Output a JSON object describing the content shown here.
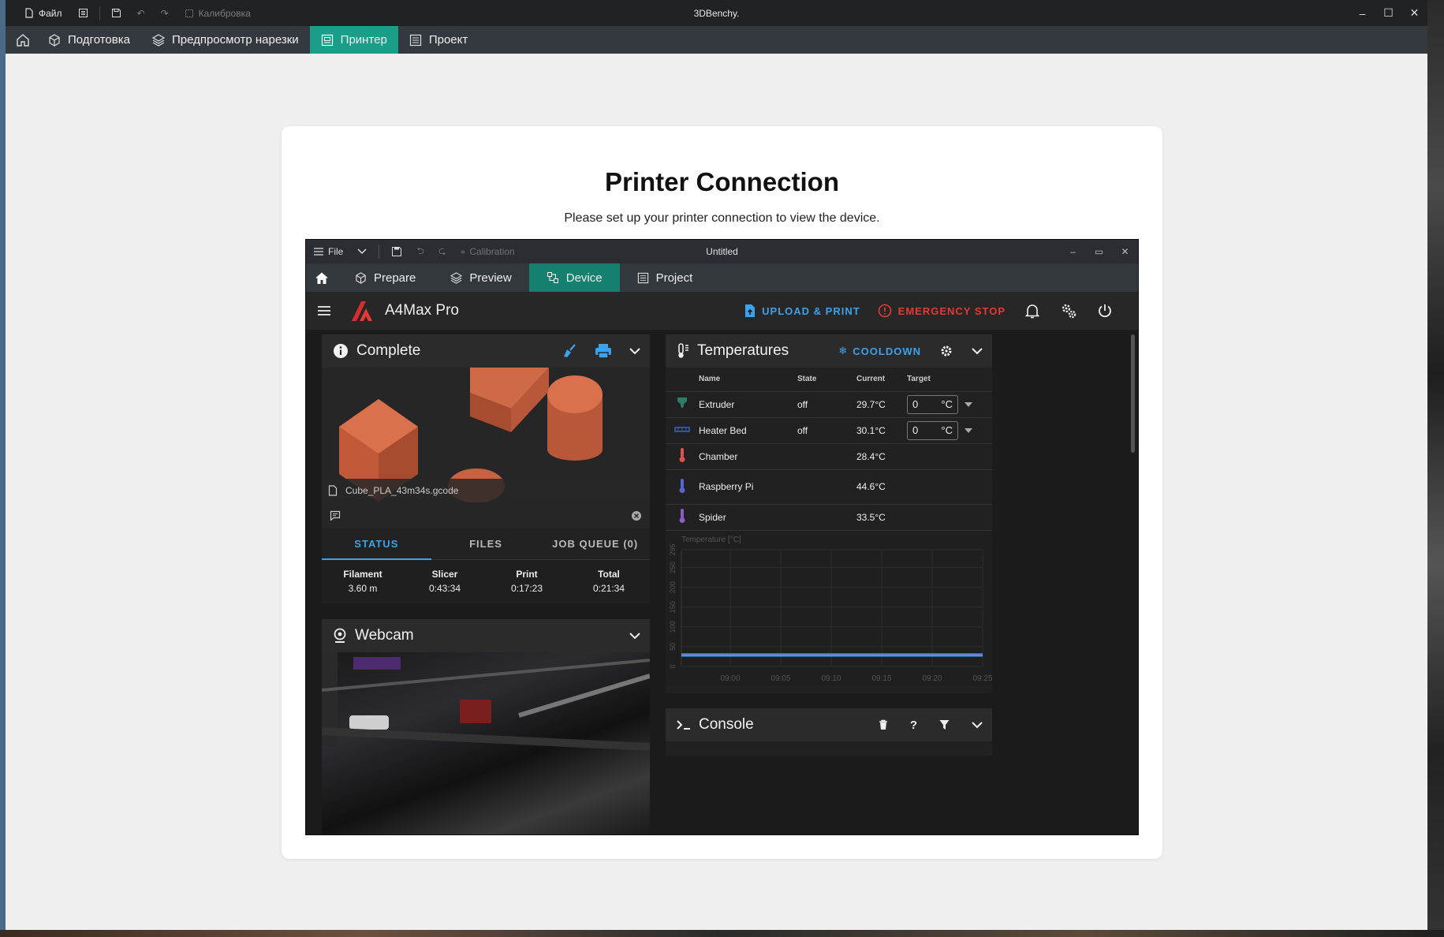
{
  "app": {
    "title": "3DBenchy.",
    "toolbar": {
      "file": "Файл",
      "calibration": "Калибровка"
    },
    "tabs": [
      {
        "label": "Подготовка"
      },
      {
        "label": "Предпросмотр нарезки"
      },
      {
        "label": "Принтер"
      },
      {
        "label": "Проект"
      }
    ]
  },
  "card": {
    "title": "Printer Connection",
    "subtitle": "Please set up your printer connection to view the device."
  },
  "device": {
    "window_title": "Untitled",
    "toolbar": {
      "file": "File",
      "calibration": "Calibration"
    },
    "tabs": [
      {
        "label": "Prepare"
      },
      {
        "label": "Preview"
      },
      {
        "label": "Device"
      },
      {
        "label": "Project"
      }
    ],
    "printer_name": "A4Max Pro",
    "upload_print": "UPLOAD & PRINT",
    "emergency_stop": "EMERGENCY STOP",
    "status_panel": {
      "title": "Complete",
      "filename": "Cube_PLA_43m34s.gcode",
      "tabs": [
        "STATUS",
        "FILES",
        "JOB QUEUE (0)"
      ],
      "stats": [
        {
          "label": "Filament",
          "value": "3.60 m"
        },
        {
          "label": "Slicer",
          "value": "0:43:34"
        },
        {
          "label": "Print",
          "value": "0:17:23"
        },
        {
          "label": "Total",
          "value": "0:21:34"
        }
      ]
    },
    "webcam": {
      "title": "Webcam"
    },
    "temperatures": {
      "title": "Temperatures",
      "cooldown": "COOLDOWN",
      "columns": {
        "name": "Name",
        "state": "State",
        "current": "Current",
        "target": "Target"
      },
      "rows": [
        {
          "name": "Extruder",
          "state": "off",
          "current": "29.7°C",
          "target": "0",
          "unit": "°C",
          "icon_color": "#2e7d68"
        },
        {
          "name": "Heater Bed",
          "state": "off",
          "current": "30.1°C",
          "target": "0",
          "unit": "°C",
          "icon_color": "#3b5bbf"
        },
        {
          "name": "Chamber",
          "state": "",
          "current": "28.4°C",
          "target": "",
          "unit": "",
          "icon_color": "#d9534f"
        },
        {
          "name": "Raspberry Pi",
          "state": "",
          "current": "44.6°C",
          "target": "",
          "unit": "",
          "icon_color": "#5565d8"
        },
        {
          "name": "Spider",
          "state": "",
          "current": "33.5°C",
          "target": "",
          "unit": "",
          "icon_color": "#8a5ec4"
        }
      ]
    },
    "console": {
      "title": "Console"
    }
  },
  "chart_data": {
    "type": "line",
    "title": "",
    "ylabel": "Temperature [°C]",
    "xlabel": "",
    "ylim": [
      0,
      295
    ],
    "yticks": [
      0,
      50,
      100,
      150,
      200,
      250,
      295
    ],
    "x": [
      "09:00",
      "09:05",
      "09:10",
      "09:15",
      "09:20",
      "09:25"
    ],
    "series": [
      {
        "name": "",
        "color": "#5565d8",
        "values": [
          30,
          30,
          30,
          30,
          30,
          30
        ]
      },
      {
        "name": "",
        "color": "#3da2ec",
        "values": [
          28,
          28,
          28,
          28,
          28,
          28
        ]
      },
      {
        "name": "",
        "color": "#8a5ec4",
        "values": [
          32,
          32,
          32,
          32,
          32,
          32
        ]
      }
    ]
  }
}
